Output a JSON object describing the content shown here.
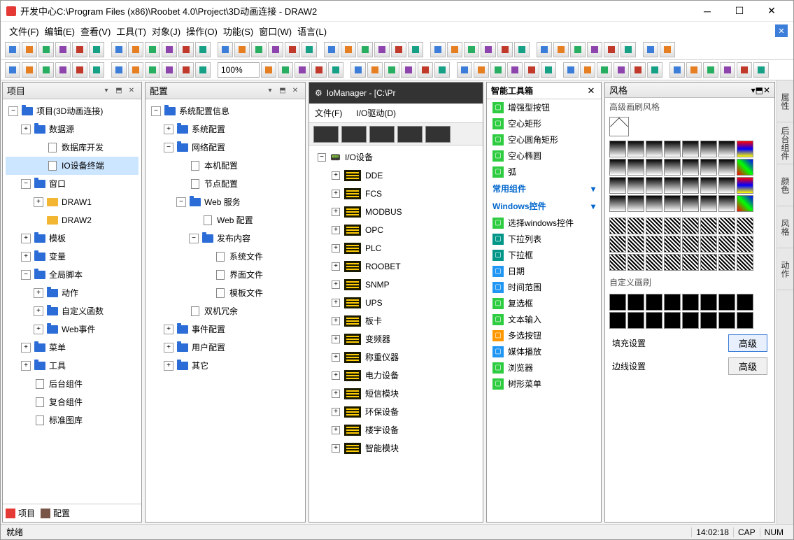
{
  "title": "开发中心C:\\Program Files (x86)\\Roobet 4.0\\Project\\3D动画连接 - DRAW2",
  "menubar": [
    "文件(F)",
    "编辑(E)",
    "查看(V)",
    "工具(T)",
    "对象(J)",
    "操作(O)",
    "功能(S)",
    "窗口(W)",
    "语言(L)"
  ],
  "zoom": "100%",
  "projectPanel": {
    "title": "项目",
    "root": "项目(3D动画连接)",
    "items": [
      {
        "t": "数据源",
        "lvl": 1,
        "exp": "+",
        "ic": "fb"
      },
      {
        "t": "数据库开发",
        "lvl": 2,
        "ic": "doc"
      },
      {
        "t": "IO设备终端",
        "lvl": 2,
        "ic": "doc",
        "sel": true
      },
      {
        "t": "窗口",
        "lvl": 1,
        "exp": "-",
        "ic": "fb"
      },
      {
        "t": "DRAW1",
        "lvl": 2,
        "exp": "+",
        "ic": "fy"
      },
      {
        "t": "DRAW2",
        "lvl": 2,
        "ic": "fy"
      },
      {
        "t": "模板",
        "lvl": 1,
        "exp": "+",
        "ic": "fb"
      },
      {
        "t": "变量",
        "lvl": 1,
        "exp": "+",
        "ic": "fb"
      },
      {
        "t": "全局脚本",
        "lvl": 1,
        "exp": "-",
        "ic": "fb"
      },
      {
        "t": "动作",
        "lvl": 2,
        "exp": "+",
        "ic": "fb"
      },
      {
        "t": "自定义函数",
        "lvl": 2,
        "exp": "+",
        "ic": "fb"
      },
      {
        "t": "Web事件",
        "lvl": 2,
        "exp": "+",
        "ic": "fb"
      },
      {
        "t": "菜单",
        "lvl": 1,
        "exp": "+",
        "ic": "fb"
      },
      {
        "t": "工具",
        "lvl": 1,
        "exp": "+",
        "ic": "fb"
      },
      {
        "t": "后台组件",
        "lvl": 1,
        "ic": "doc"
      },
      {
        "t": "复合组件",
        "lvl": 1,
        "ic": "doc"
      },
      {
        "t": "标准图库",
        "lvl": 1,
        "ic": "doc"
      }
    ],
    "tabs": [
      "项目",
      "配置"
    ]
  },
  "configPanel": {
    "title": "配置",
    "root": "系统配置信息",
    "items": [
      {
        "t": "系统配置",
        "lvl": 1,
        "exp": "+",
        "ic": "fb"
      },
      {
        "t": "网络配置",
        "lvl": 1,
        "exp": "-",
        "ic": "fb"
      },
      {
        "t": "本机配置",
        "lvl": 2,
        "ic": "doc"
      },
      {
        "t": "节点配置",
        "lvl": 2,
        "ic": "doc"
      },
      {
        "t": "Web 服务",
        "lvl": 2,
        "exp": "-",
        "ic": "fb"
      },
      {
        "t": "Web 配置",
        "lvl": 3,
        "ic": "doc"
      },
      {
        "t": "发布内容",
        "lvl": 3,
        "exp": "-",
        "ic": "fb"
      },
      {
        "t": "系统文件",
        "lvl": 4,
        "ic": "doc"
      },
      {
        "t": "界面文件",
        "lvl": 4,
        "ic": "doc"
      },
      {
        "t": "模板文件",
        "lvl": 4,
        "ic": "doc"
      },
      {
        "t": "双机冗余",
        "lvl": 2,
        "ic": "doc"
      },
      {
        "t": "事件配置",
        "lvl": 1,
        "exp": "+",
        "ic": "fb"
      },
      {
        "t": "用户配置",
        "lvl": 1,
        "exp": "+",
        "ic": "fb"
      },
      {
        "t": "其它",
        "lvl": 1,
        "exp": "+",
        "ic": "fb"
      }
    ]
  },
  "ioManager": {
    "title": "IoManager - [C:\\Pr",
    "menu": [
      "文件(F)",
      "I/O驱动(D)"
    ],
    "root": "I/O设备",
    "items": [
      "DDE",
      "FCS",
      "MODBUS",
      "OPC",
      "PLC",
      "ROOBET",
      "SNMP",
      "UPS",
      "板卡",
      "变频器",
      "称重仪器",
      "电力设备",
      "短信模块",
      "环保设备",
      "楼宇设备",
      "智能模块"
    ]
  },
  "toolbox": {
    "title": "智能工具箱",
    "groups": [
      {
        "cat": null,
        "items": [
          {
            "t": "增强型按钮",
            "c": "bg-green"
          },
          {
            "t": "空心矩形",
            "c": "bg-green"
          },
          {
            "t": "空心圆角矩形",
            "c": "bg-green"
          },
          {
            "t": "空心椭圆",
            "c": "bg-green"
          },
          {
            "t": "弧",
            "c": "bg-green"
          }
        ]
      },
      {
        "cat": "常用组件",
        "items": []
      },
      {
        "cat": "Windows控件",
        "items": [
          {
            "t": "选择windows控件",
            "c": "bg-green"
          },
          {
            "t": "下拉列表",
            "c": "bg-teal"
          },
          {
            "t": "下拉框",
            "c": "bg-teal"
          },
          {
            "t": "日期",
            "c": "bg-blue"
          },
          {
            "t": "时间范围",
            "c": "bg-blue"
          },
          {
            "t": "复选框",
            "c": "bg-green"
          },
          {
            "t": "文本输入",
            "c": "bg-green"
          },
          {
            "t": "多选按钮",
            "c": "bg-orange"
          },
          {
            "t": "媒体播放",
            "c": "bg-blue"
          },
          {
            "t": "浏览器",
            "c": "bg-green"
          },
          {
            "t": "树形菜单",
            "c": "bg-green"
          }
        ]
      }
    ]
  },
  "styles": {
    "title": "风格",
    "sec1": "高级画刷风格",
    "sec2": "自定义画刷",
    "fillLabel": "填充设置",
    "edgeLabel": "边线设置",
    "btnAdv": "高级"
  },
  "sideTabs": [
    "属性",
    "后台组件",
    "颜色",
    "风格",
    "动作"
  ],
  "status": {
    "ready": "就绪",
    "time": "14:02:18",
    "cap": "CAP",
    "num": "NUM"
  }
}
